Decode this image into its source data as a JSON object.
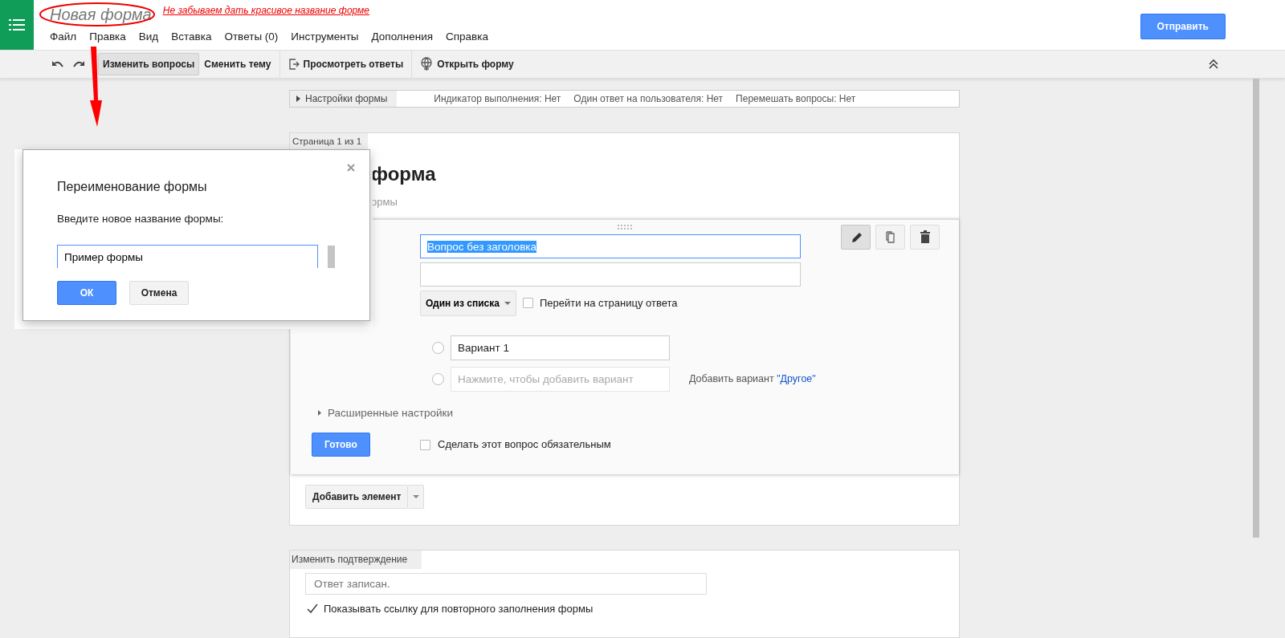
{
  "header": {
    "title": "Новая форма",
    "annotation": "Не забываем дать красивое название форме",
    "menu": [
      "Файл",
      "Правка",
      "Вид",
      "Вставка",
      "Ответы (0)",
      "Инструменты",
      "Дополнения",
      "Справка"
    ],
    "send_button": "Отправить"
  },
  "toolbar": {
    "buttons": [
      {
        "kind": "text",
        "label": "Изменить вопросы",
        "selected": true
      },
      {
        "kind": "text",
        "label": "Сменить тему",
        "selected": false
      },
      {
        "kind": "responses",
        "label": "Просмотреть ответы",
        "selected": false
      },
      {
        "kind": "open",
        "label": "Открыть форму",
        "selected": false
      }
    ]
  },
  "form_settings": {
    "label": "Настройки формы",
    "summary": [
      "Индикатор выполнения: Нет",
      "Один ответ на пользователя: Нет",
      "Перемешать вопросы: Нет"
    ]
  },
  "page": {
    "tab": "Страница 1 из 1",
    "title_fragment": "форма",
    "description_fragment": "ормы"
  },
  "question": {
    "tools": [
      {
        "kind": "edit",
        "selected": true
      },
      {
        "kind": "copy",
        "selected": false
      },
      {
        "kind": "delete",
        "selected": false
      }
    ],
    "title": "Вопрос без заголовка",
    "title_selected": true,
    "type": "Один из списка",
    "go_to_page": {
      "label": "Перейти на страницу ответа",
      "checked": false
    },
    "options": [
      {
        "kind": "option",
        "value": "Вариант 1",
        "checked": false
      },
      {
        "kind": "new",
        "placeholder": "Нажмите, чтобы добавить вариант",
        "checked": false
      }
    ],
    "add_other": {
      "text": "Добавить вариант",
      "link": "\"Другое\""
    },
    "advanced": "Расширенные настройки",
    "done": "Готово",
    "required": {
      "label": "Сделать этот вопрос обязательным",
      "checked": false
    }
  },
  "add_item": "Добавить элемент",
  "confirmation": {
    "tab": "Изменить подтверждение",
    "placeholder": "Ответ записан.",
    "show_link": {
      "label": "Показывать ссылку для повторного заполнения формы",
      "checked": true
    }
  },
  "dialog": {
    "title": "Переименование формы",
    "prompt": "Введите новое название формы:",
    "value": "Пример формы",
    "ok": "ОК",
    "cancel": "Отмена"
  }
}
